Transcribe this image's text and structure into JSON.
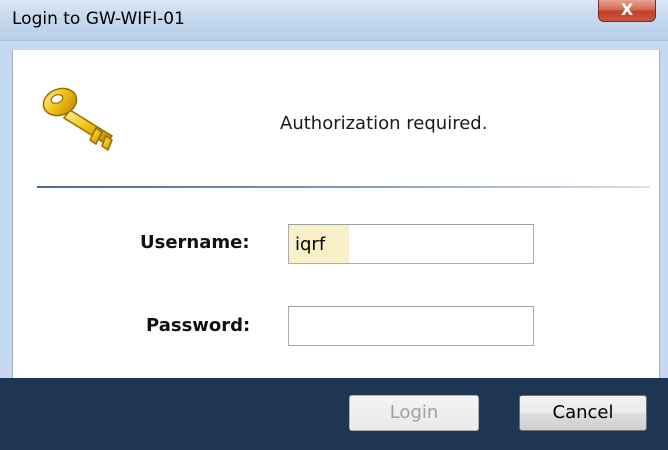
{
  "window": {
    "title": "Login to GW-WIFI-01",
    "close_glyph": "X"
  },
  "dialog": {
    "icon": "key-icon",
    "message": "Authorization required.",
    "fields": {
      "username_label": "Username:",
      "username_value": "iqrf",
      "password_label": "Password:",
      "password_value": ""
    },
    "buttons": {
      "login_label": "Login",
      "login_enabled": false,
      "cancel_label": "Cancel"
    }
  },
  "colors": {
    "titlebar": "#c6d9ef",
    "footer": "#1f3554",
    "close_button": "#c9573f",
    "autofill_highlight": "#faf0c8",
    "key_gold": "#f2c21a"
  }
}
